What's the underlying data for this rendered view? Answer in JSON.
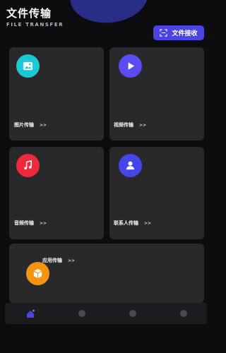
{
  "header": {
    "title": "文件传输",
    "subtitle": "FILE TRANSFER",
    "receive_button": "文件接收"
  },
  "cards": [
    {
      "id": "photo",
      "label": "图片传输",
      "arrow": ">>",
      "icon": "image-icon",
      "color": "#19c9d3"
    },
    {
      "id": "video",
      "label": "视频传输",
      "arrow": ">>",
      "icon": "play-icon",
      "color": "#5a4cf0"
    },
    {
      "id": "audio",
      "label": "音频传输",
      "arrow": ">>",
      "icon": "music-note-icon",
      "color": "#ec2a3a"
    },
    {
      "id": "contact",
      "label": "联系人传输",
      "arrow": ">>",
      "icon": "person-icon",
      "color": "#4646e6"
    },
    {
      "id": "app",
      "label": "应用传输",
      "arrow": ">>",
      "icon": "box-icon",
      "color": "#f5940e"
    }
  ],
  "bottom_nav": {
    "items": [
      "home-icon",
      "nav-icon-2",
      "nav-icon-3",
      "nav-icon-4"
    ],
    "active": 0,
    "active_color": "#4b44e2"
  }
}
